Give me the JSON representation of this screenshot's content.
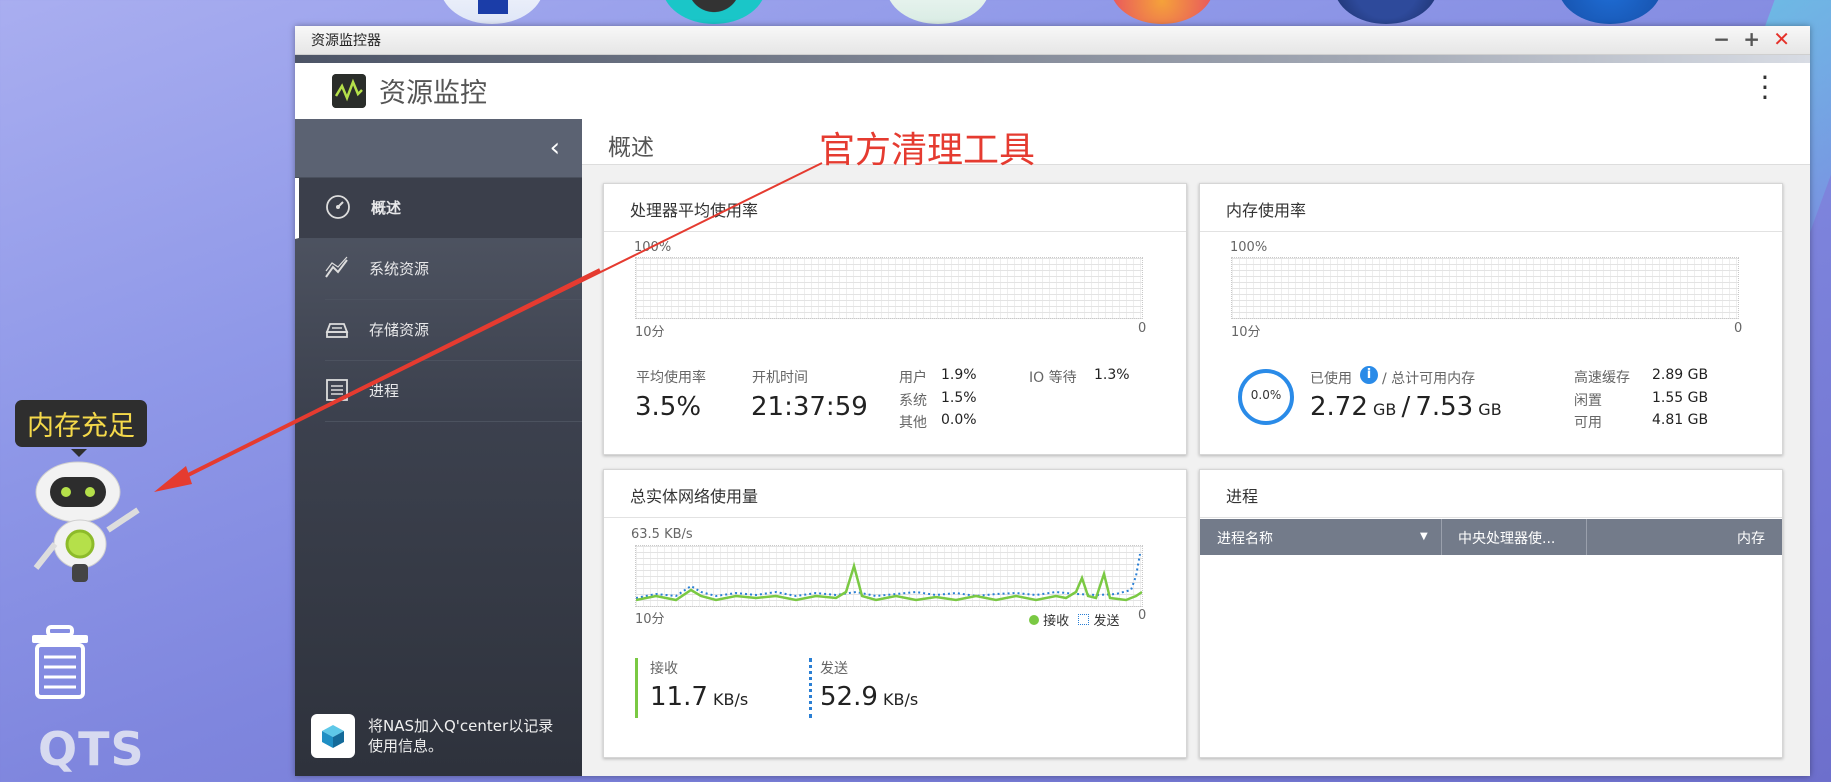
{
  "window": {
    "title": "资源监控器",
    "app_title": "资源监控"
  },
  "sidebar": {
    "items": [
      {
        "label": "概述"
      },
      {
        "label": "系统资源"
      },
      {
        "label": "存储资源"
      },
      {
        "label": "进程"
      }
    ],
    "qcenter_text": "将NAS加入Q'center以记录使用信息。"
  },
  "main": {
    "title": "概述"
  },
  "annotation": {
    "text": "官方清理工具",
    "color": "#e53b30"
  },
  "desktop": {
    "tooltip": "内存充足",
    "logo_text": "QTS"
  },
  "cpu": {
    "title": "处理器平均使用率",
    "y_top": "100%",
    "x_left": "10分",
    "x_right": "0",
    "avg_label": "平均使用率",
    "avg_value": "3.5%",
    "uptime_label": "开机时间",
    "uptime_value": "21:37:59",
    "user_label": "用户",
    "user_value": "1.9%",
    "system_label": "系统",
    "system_value": "1.5%",
    "other_label": "其他",
    "other_value": "0.0%",
    "io_label": "IO 等待",
    "io_value": "1.3%"
  },
  "memory": {
    "title": "内存使用率",
    "y_top": "100%",
    "x_left": "10分",
    "x_right": "0",
    "ring_value": "0.0%",
    "used_label": "已使用",
    "total_label": "/ 总计可用内存",
    "used_value": "2.72",
    "used_unit": "GB",
    "sep": "/",
    "total_value": "7.53",
    "total_unit": "GB",
    "cache_label": "高速缓存",
    "cache_value": "2.89 GB",
    "free_label": "闲置",
    "free_value": "1.55 GB",
    "avail_label": "可用",
    "avail_value": "4.81 GB"
  },
  "network": {
    "title": "总实体网络使用量",
    "y_top": "63.5 KB/s",
    "x_left": "10分",
    "x_right": "0",
    "legend_rx": "接收",
    "legend_tx": "发送",
    "rx_label": "接收",
    "rx_value": "11.7",
    "rx_unit": "KB/s",
    "tx_label": "发送",
    "tx_value": "52.9",
    "tx_unit": "KB/s",
    "rx_color": "#7ac943",
    "tx_color": "#2a7fd4"
  },
  "process": {
    "title": "进程",
    "columns": [
      "进程名称",
      "中央处理器使...",
      "内存"
    ]
  },
  "colors": {
    "accent": "#2a8be8",
    "sidebar": "#3c414e",
    "annotation": "#e53b30"
  }
}
